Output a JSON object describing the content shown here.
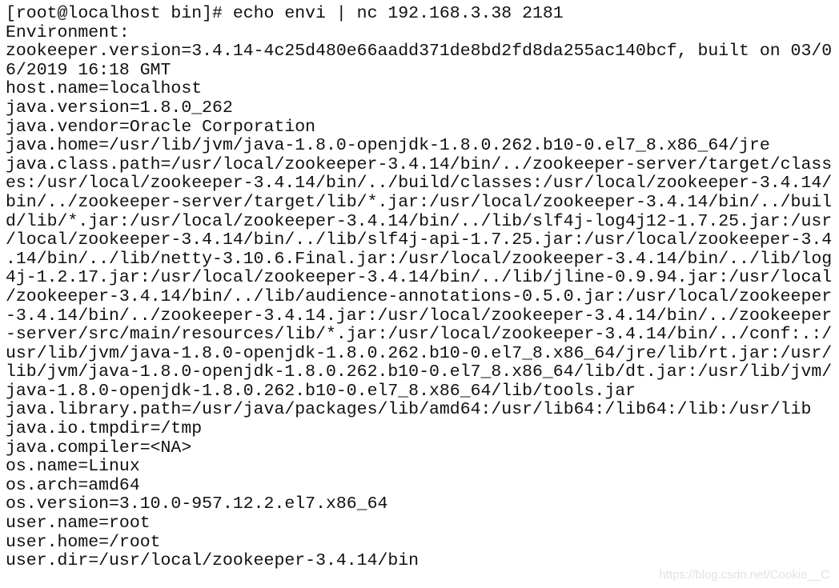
{
  "terminal": {
    "lines": [
      "[root@localhost bin]# echo envi | nc 192.168.3.38 2181",
      "Environment:",
      "zookeeper.version=3.4.14-4c25d480e66aadd371de8bd2fd8da255ac140bcf, built on 03/0",
      "6/2019 16:18 GMT",
      "host.name=localhost",
      "java.version=1.8.0_262",
      "java.vendor=Oracle Corporation",
      "java.home=/usr/lib/jvm/java-1.8.0-openjdk-1.8.0.262.b10-0.el7_8.x86_64/jre",
      "java.class.path=/usr/local/zookeeper-3.4.14/bin/../zookeeper-server/target/class",
      "es:/usr/local/zookeeper-3.4.14/bin/../build/classes:/usr/local/zookeeper-3.4.14/",
      "bin/../zookeeper-server/target/lib/*.jar:/usr/local/zookeeper-3.4.14/bin/../buil",
      "d/lib/*.jar:/usr/local/zookeeper-3.4.14/bin/../lib/slf4j-log4j12-1.7.25.jar:/usr",
      "/local/zookeeper-3.4.14/bin/../lib/slf4j-api-1.7.25.jar:/usr/local/zookeeper-3.4",
      ".14/bin/../lib/netty-3.10.6.Final.jar:/usr/local/zookeeper-3.4.14/bin/../lib/log",
      "4j-1.2.17.jar:/usr/local/zookeeper-3.4.14/bin/../lib/jline-0.9.94.jar:/usr/local",
      "/zookeeper-3.4.14/bin/../lib/audience-annotations-0.5.0.jar:/usr/local/zookeeper",
      "-3.4.14/bin/../zookeeper-3.4.14.jar:/usr/local/zookeeper-3.4.14/bin/../zookeeper",
      "-server/src/main/resources/lib/*.jar:/usr/local/zookeeper-3.4.14/bin/../conf:.:/",
      "usr/lib/jvm/java-1.8.0-openjdk-1.8.0.262.b10-0.el7_8.x86_64/jre/lib/rt.jar:/usr/",
      "lib/jvm/java-1.8.0-openjdk-1.8.0.262.b10-0.el7_8.x86_64/lib/dt.jar:/usr/lib/jvm/",
      "java-1.8.0-openjdk-1.8.0.262.b10-0.el7_8.x86_64/lib/tools.jar",
      "java.library.path=/usr/java/packages/lib/amd64:/usr/lib64:/lib64:/lib:/usr/lib",
      "java.io.tmpdir=/tmp",
      "java.compiler=<NA>",
      "os.name=Linux",
      "os.arch=amd64",
      "os.version=3.10.0-957.12.2.el7.x86_64",
      "user.name=root",
      "user.home=/root",
      "user.dir=/usr/local/zookeeper-3.4.14/bin"
    ]
  },
  "watermark": "https://blog.csdn.net/Cookie__C"
}
